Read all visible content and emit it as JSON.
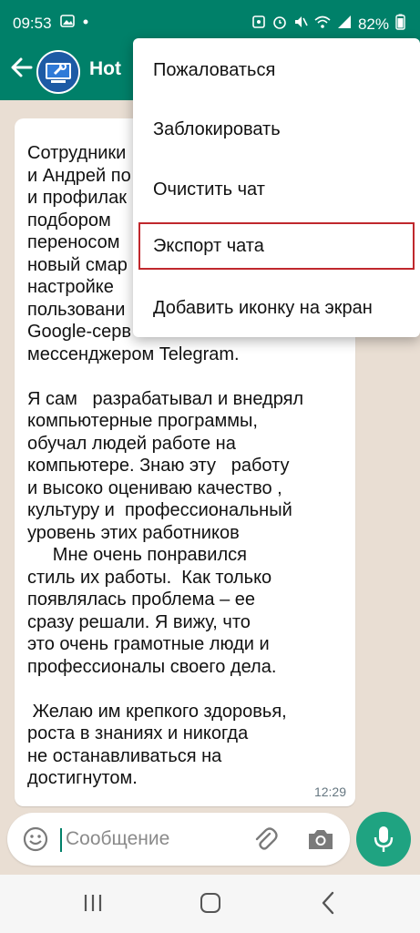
{
  "status_bar": {
    "time": "09:53",
    "battery": "82%"
  },
  "chat": {
    "title": "Hot",
    "message_text": "Сотрудники\nи Андрей по\nи профилак\nподбором\nпереносом\nновый смар\nнастройке\nпользовани\nGoogle-серв\nмессенджером Telegram.\n\nЯ сам   разрабатывал и внедрял\nкомпьютерные программы,\nобучал людей работе на\nкомпьютере. Знаю эту   работу\nи высоко оцениваю качество ,\nкультуру и  профессиональный\nуровень этих работников\n     Мне очень понравился\nстиль их работы.  Как только\nпоявлялась проблема – ее\nсразу решали. Я вижу, что\nэто очень грамотные люди и\nпрофессионалы своего дела.\n\n Желаю им крепкого здоровья,\nроста в знаниях и никогда\nне останавливаться на\nдостигнутом.",
    "message_time": "12:29"
  },
  "menu": {
    "items": [
      {
        "label": "Пожаловаться"
      },
      {
        "label": "Заблокировать"
      },
      {
        "label": "Очистить чат"
      },
      {
        "label": "Экспорт чата"
      },
      {
        "label": "Добавить иконку на экран"
      }
    ]
  },
  "input": {
    "placeholder": "Сообщение"
  },
  "colors": {
    "header": "#008069",
    "mic_button": "#1fa381",
    "highlight_border": "#c0282d"
  }
}
